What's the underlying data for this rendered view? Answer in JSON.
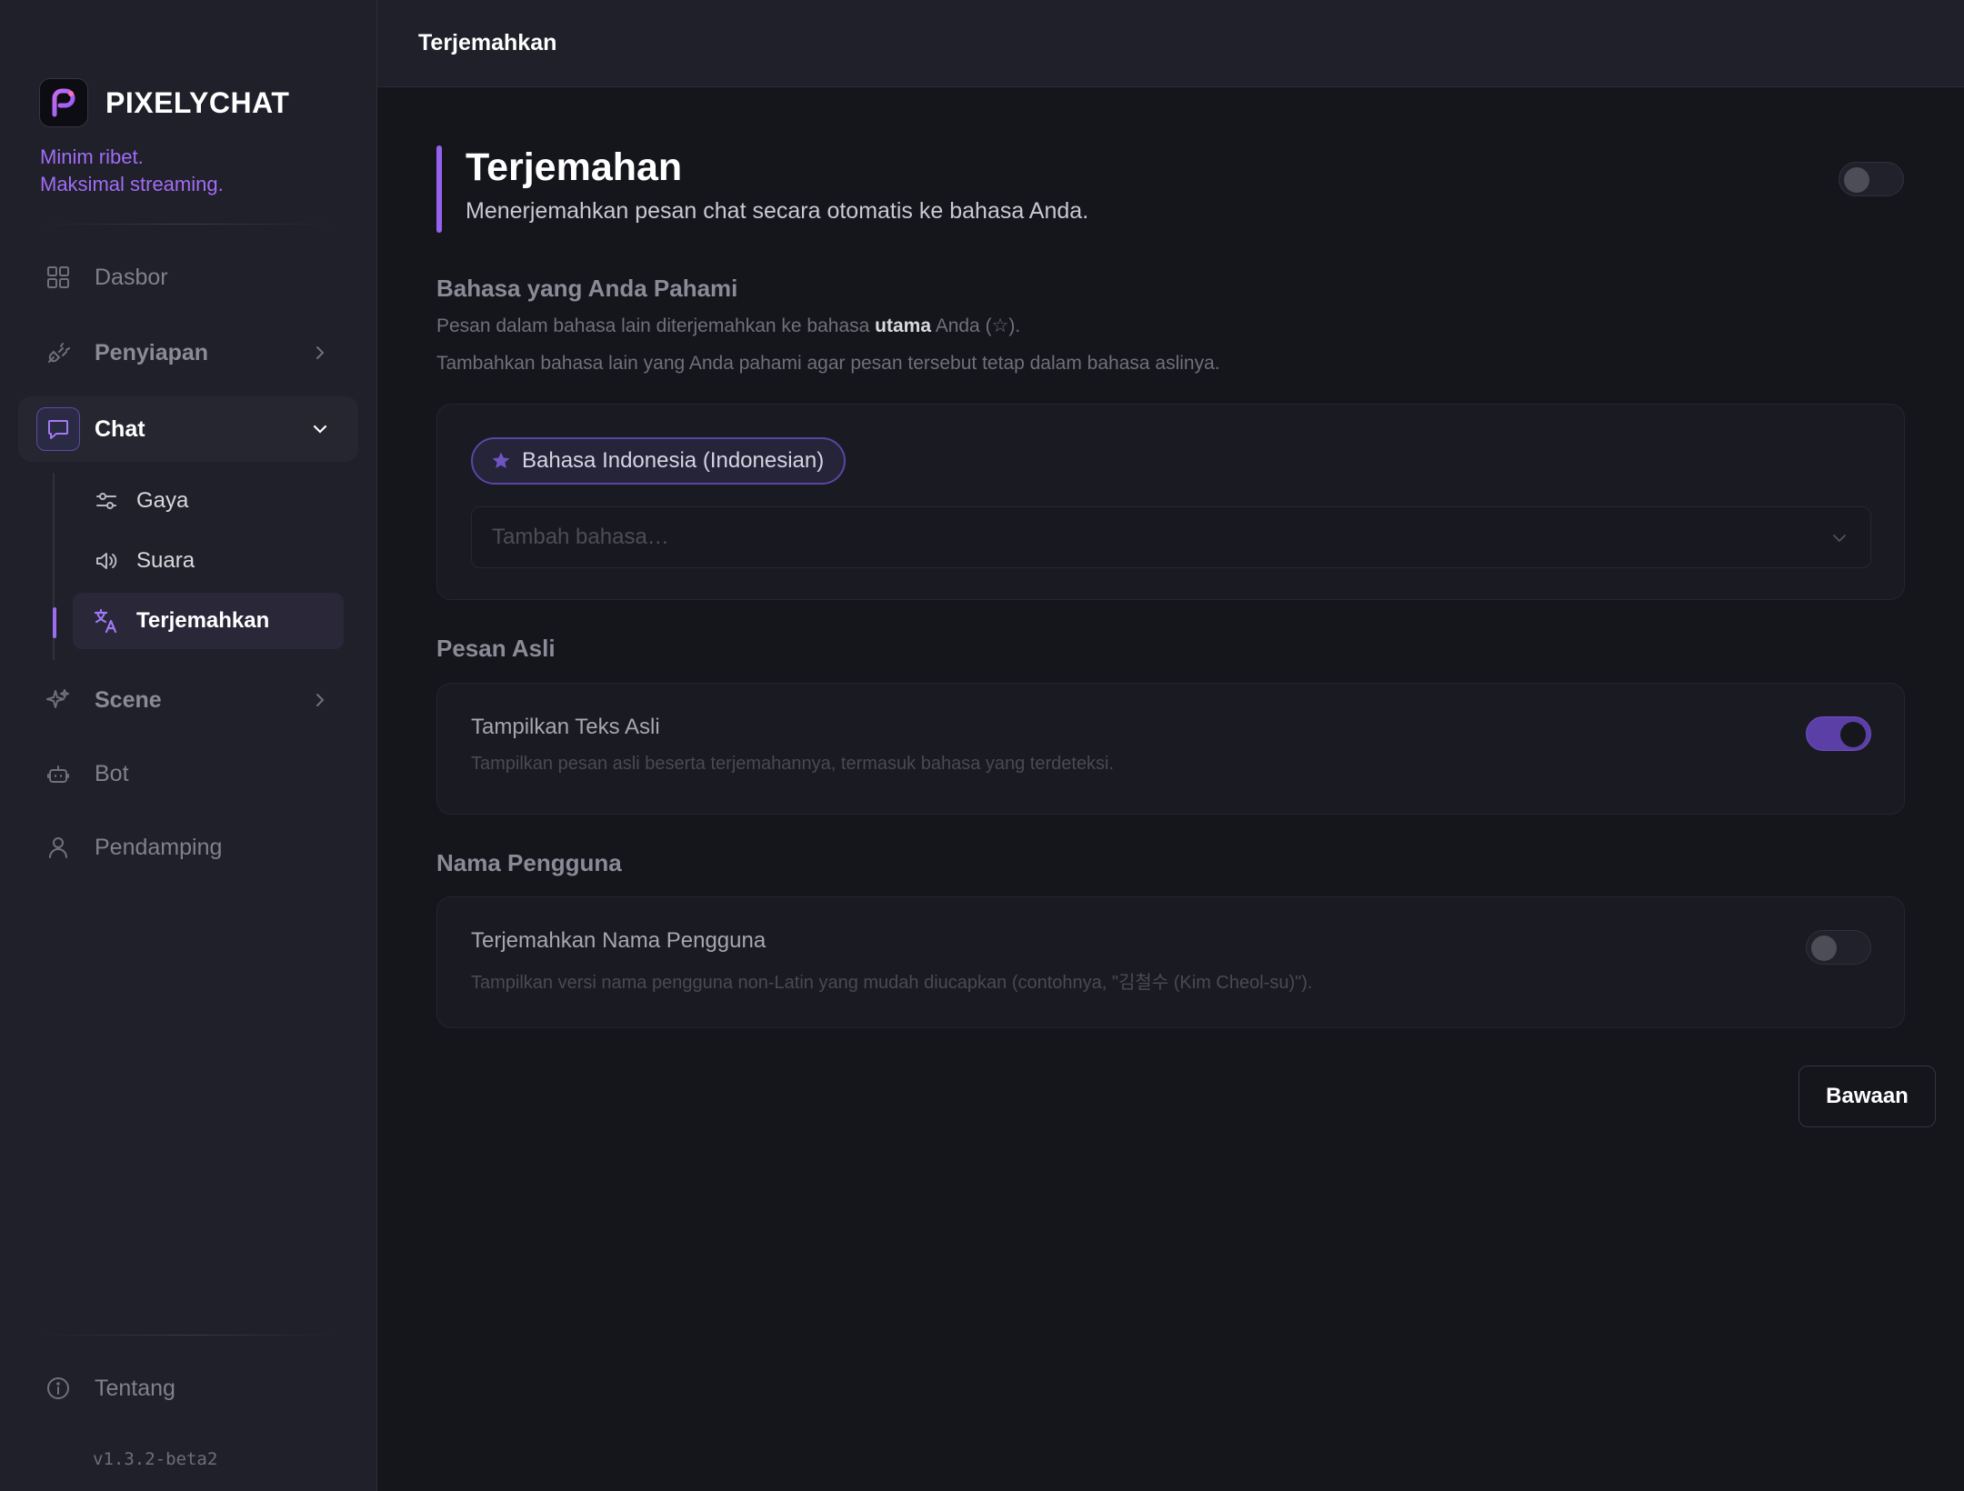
{
  "brand": {
    "name": "PIXELYCHAT",
    "tagline_line1": "Minim ribet.",
    "tagline_line2": "Maksimal streaming.",
    "accent_color": "#a26cf6"
  },
  "sidebar": {
    "items": [
      {
        "label": "Dasbor",
        "icon": "grid-icon"
      },
      {
        "label": "Penyiapan",
        "icon": "plug-icon",
        "expandable": true,
        "expanded": false
      },
      {
        "label": "Chat",
        "icon": "chat-bubble-icon",
        "expandable": true,
        "expanded": true
      },
      {
        "label": "Scene",
        "icon": "sparkles-icon",
        "expandable": true,
        "expanded": false
      },
      {
        "label": "Bot",
        "icon": "robot-icon"
      },
      {
        "label": "Pendamping",
        "icon": "user-icon"
      }
    ],
    "chat_subitems": [
      {
        "label": "Gaya",
        "icon": "sliders-icon"
      },
      {
        "label": "Suara",
        "icon": "speaker-icon"
      },
      {
        "label": "Terjemahkan",
        "icon": "translate-icon",
        "active": true
      }
    ],
    "footer_item": {
      "label": "Tentang",
      "icon": "info-icon"
    },
    "version": "v1.3.2-beta2"
  },
  "topbar": {
    "title": "Terjemahkan"
  },
  "page": {
    "title": "Terjemahan",
    "description": "Menerjemahkan pesan chat secara otomatis ke bahasa Anda.",
    "enabled": false
  },
  "languages": {
    "title": "Bahasa yang Anda Pahami",
    "desc1_before": "Pesan dalam bahasa lain diterjemahkan ke bahasa ",
    "desc1_bold": "utama",
    "desc1_after": " Anda (☆).",
    "desc2": "Tambahkan bahasa lain yang Anda pahami agar pesan tersebut tetap dalam bahasa aslinya.",
    "primary_language": "Bahasa Indonesia (Indonesian)",
    "add_placeholder": "Tambah bahasa…"
  },
  "original_message": {
    "title": "Pesan Asli",
    "option_title": "Tampilkan Teks Asli",
    "option_desc": "Tampilkan pesan asli beserta terjemahannya, termasuk bahasa yang terdeteksi.",
    "enabled": true
  },
  "username": {
    "title": "Nama Pengguna",
    "option_title": "Terjemahkan Nama Pengguna",
    "option_desc": "Tampilkan versi nama pengguna non-Latin yang mudah diucapkan (contohnya, \"김철수 (Kim Cheol-su)\").",
    "enabled": false
  },
  "actions": {
    "default_label": "Bawaan"
  }
}
